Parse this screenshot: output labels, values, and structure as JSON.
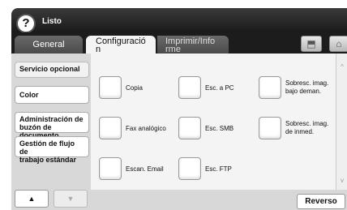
{
  "status": {
    "title": "Listo",
    "help_glyph": "?"
  },
  "tabs": [
    {
      "label_line1": "General",
      "label_line2": ""
    },
    {
      "label_line1": "Configuració",
      "label_line2": "n"
    },
    {
      "label_line1": "Imprimir/Info",
      "label_line2": "rme"
    }
  ],
  "toolbar": {
    "icon1": "⬒",
    "icon2": "⌂"
  },
  "nav": {
    "items": [
      {
        "line1": "Servicio opcional",
        "line2": ""
      },
      {
        "line1": "Color",
        "line2": ""
      },
      {
        "line1": "Administración de",
        "line2": "buzón de documento"
      },
      {
        "line1": "Gestión de flujo de",
        "line2": "trabajo estándar"
      }
    ],
    "up": "▲",
    "down": "▼"
  },
  "options": [
    {
      "line1": "Copia",
      "line2": ""
    },
    {
      "line1": "Esc. a PC",
      "line2": ""
    },
    {
      "line1": "Sobresc. imag.",
      "line2": "bajo deman."
    },
    {
      "line1": "Fax analógico",
      "line2": ""
    },
    {
      "line1": "Esc. SMB",
      "line2": ""
    },
    {
      "line1": "Sobresc. imag.",
      "line2": "de inmed."
    },
    {
      "line1": "Escan. Email",
      "line2": ""
    },
    {
      "line1": "Esc. FTP",
      "line2": ""
    }
  ],
  "scroll": {
    "up": "^",
    "down": "v"
  },
  "footer": {
    "reverso": "Reverso"
  }
}
